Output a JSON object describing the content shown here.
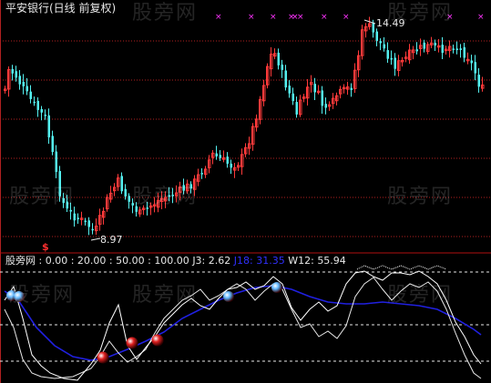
{
  "title": "平安银行(日线 前复权)",
  "price_panel": {
    "high_label": "14.49",
    "low_label": "8.97",
    "signal_mark": "$"
  },
  "indicator_panel": {
    "name": "股旁网",
    "levels": [
      "0.00",
      "20.00",
      "50.00",
      "100.00"
    ],
    "j3_label": "J3:",
    "j3_value": "2.62",
    "j18_label": "J18:",
    "j18_value": "31.35",
    "w12_label": "W12:",
    "w12_value": "55.94"
  },
  "watermark_text": "股旁网",
  "colors": {
    "background": "#000000",
    "up_candle": "#ff3a3a",
    "down_candle": "#54f0f0",
    "grid": "#b02020",
    "divider": "#b01010",
    "cross_mark": "#ff33ff",
    "j3_line": "#ffffff",
    "j18_line": "#2020e0",
    "w12_line": "#e8e8e8",
    "dashed_level": "#e8e8e8",
    "legend_levels": "#e8e8e8",
    "j18_text": "#3030ff",
    "buy_ball": "#e02020",
    "top_ball": "#60b8ff"
  },
  "chart_data": {
    "type": "candlestick",
    "series": [
      {
        "name": "J3"
      },
      {
        "name": "J18"
      },
      {
        "name": "W12"
      }
    ]
  }
}
